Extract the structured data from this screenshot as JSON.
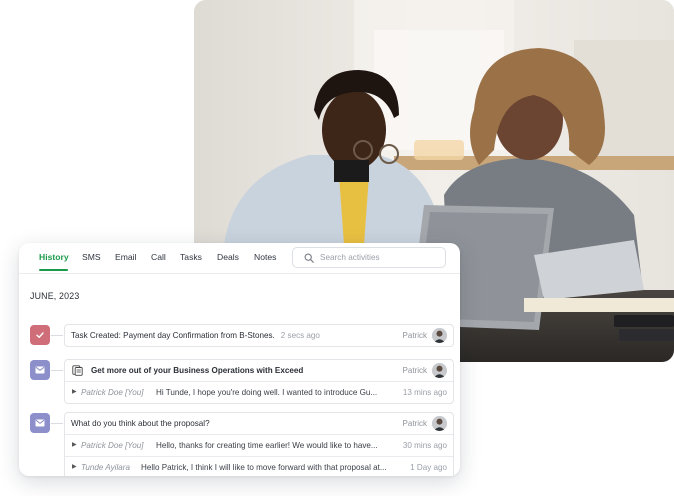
{
  "tabs": [
    {
      "label": "History",
      "active": true
    },
    {
      "label": "SMS"
    },
    {
      "label": "Email"
    },
    {
      "label": "Call"
    },
    {
      "label": "Tasks"
    },
    {
      "label": "Deals"
    },
    {
      "label": "Notes"
    }
  ],
  "search": {
    "placeholder": "Search activities",
    "value": ""
  },
  "month_heading": "JUNE, 2023",
  "activities": [
    {
      "icon": "check-icon",
      "icon_color": "#cf6e78",
      "title": "Task Created: Payment day Confirmation from B-Stones.",
      "time": "2 secs ago",
      "author": "Patrick"
    },
    {
      "icon": "email-icon",
      "icon_color": "#8c8fca",
      "title": "Get more out of your Business Operations with Exceed",
      "author": "Patrick",
      "messages": [
        {
          "who": "Patrick Doe [You]",
          "text": "Hi Tunde, I hope you're doing well. I wanted to introduce Gu...",
          "time": "13 mins ago"
        }
      ]
    },
    {
      "icon": "email-icon",
      "icon_color": "#8c8fca",
      "title": "What do you think about the proposal?",
      "author": "Patrick",
      "messages": [
        {
          "who": "Patrick Doe [You]",
          "text": "Hello, thanks for creating time earlier! We would like to have...",
          "time": "30 mins ago"
        },
        {
          "who": "Tunde Ayilara",
          "text": "Hello Patrick, I think I will like to move forward with that proposal at...",
          "time": "1 Day ago"
        }
      ]
    }
  ],
  "colors": {
    "accent": "#1b9a4a",
    "task": "#cf6e78",
    "email": "#8c8fca"
  }
}
